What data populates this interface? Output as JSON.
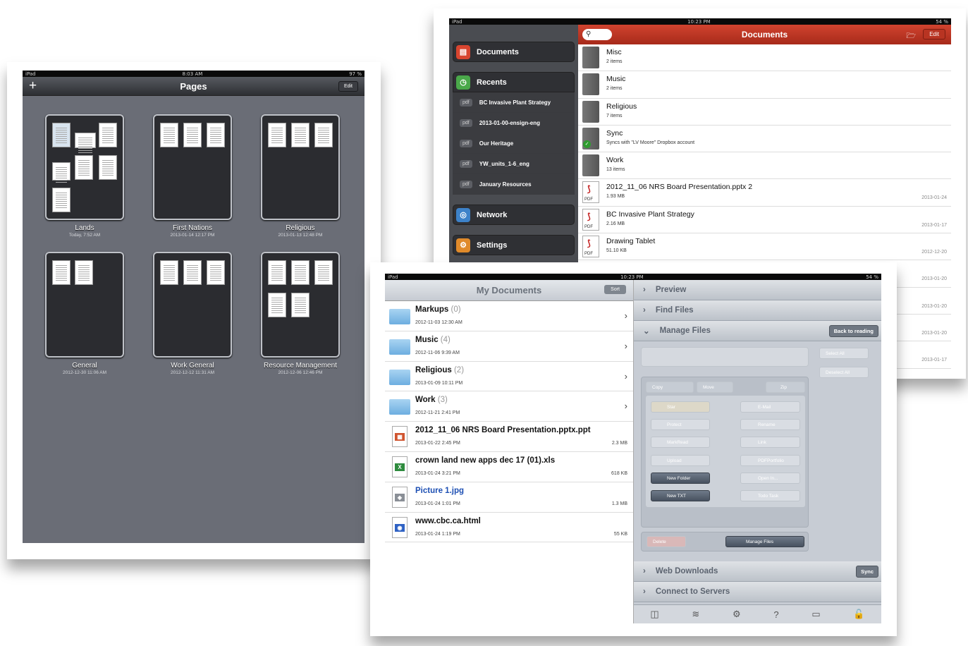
{
  "pages_app": {
    "status": {
      "left": "iPad",
      "time": "8:03 AM",
      "right": "97 %"
    },
    "nav": {
      "plus": "+",
      "title": "Pages",
      "edit": "Edit"
    },
    "folders": [
      {
        "name": "Lands",
        "date": "Today, 7:52 AM"
      },
      {
        "name": "First Nations",
        "date": "2013-01-14 12:17 PM"
      },
      {
        "name": "Religious",
        "date": "2013-01-13 12:48 PM"
      },
      {
        "name": "General",
        "date": "2012-12-30 11:06 AM"
      },
      {
        "name": "Work General",
        "date": "2012-12-12 11:31 AM"
      },
      {
        "name": "Resource Management",
        "date": "2012-12-06 12:46 PM"
      }
    ]
  },
  "documents_app": {
    "status": {
      "left": "iPad",
      "time": "10:23 PM",
      "right": "54 %"
    },
    "sidebar": {
      "documents": "Documents",
      "recents": "Recents",
      "recent_items": [
        {
          "tag": "pdf",
          "label": "BC Invasive Plant Strategy"
        },
        {
          "tag": "pdf",
          "label": "2013-01-00-ensign-eng"
        },
        {
          "tag": "pdf",
          "label": "Our Heritage"
        },
        {
          "tag": "pdf",
          "label": "YW_units_1-6_eng"
        },
        {
          "tag": "pdf",
          "label": "January Resources"
        }
      ],
      "network": "Network",
      "settings": "Settings"
    },
    "header": {
      "title": "Documents",
      "edit": "Edit"
    },
    "rows": [
      {
        "name": "Misc",
        "sub": "2 items",
        "date": "",
        "type": "folder"
      },
      {
        "name": "Music",
        "sub": "2 items",
        "date": "",
        "type": "folder"
      },
      {
        "name": "Religious",
        "sub": "7 items",
        "date": "",
        "type": "folder"
      },
      {
        "name": "Sync",
        "sub": "Syncs with \"LV Moore\" Dropbox account",
        "date": "",
        "type": "folder"
      },
      {
        "name": "Work",
        "sub": "13 items",
        "date": "",
        "type": "folder"
      },
      {
        "name": "2012_11_06 NRS Board Presentation.pptx 2",
        "sub": "1.93 MB",
        "date": "2013-01-24",
        "type": "pdf"
      },
      {
        "name": "BC Invasive Plant Strategy",
        "sub": "2.16 MB",
        "date": "2013-01-17",
        "type": "pdf"
      },
      {
        "name": "Drawing Tablet",
        "sub": "51.10 KB",
        "date": "2012-12-20",
        "type": "pdf"
      },
      {
        "name": "",
        "sub": "",
        "date": "2013-01-20",
        "type": "hidden"
      },
      {
        "name": "",
        "sub": "",
        "date": "2013-01-20",
        "type": "hidden"
      },
      {
        "name": "",
        "sub": "",
        "date": "2013-01-20",
        "type": "hidden"
      },
      {
        "name": "",
        "sub": "",
        "date": "2013-01-17",
        "type": "hidden"
      }
    ],
    "pdf_tag": "PDF"
  },
  "goodreader": {
    "status": {
      "left": "iPad",
      "time": "10:23 PM",
      "right": "54 %"
    },
    "list_header": {
      "title": "My Documents",
      "sort": "Sort"
    },
    "files": [
      {
        "name": "Markups",
        "count": "(0)",
        "date": "2012-11-03 12:30 AM",
        "size": "",
        "type": "folder"
      },
      {
        "name": "Music",
        "count": "(4)",
        "date": "2012-11-06 9:39 AM",
        "size": "",
        "type": "folder"
      },
      {
        "name": "Religious",
        "count": "(2)",
        "date": "2013-01-09 10:11 PM",
        "size": "",
        "type": "folder"
      },
      {
        "name": "Work",
        "count": "(3)",
        "date": "2012-11-21 2:41 PM",
        "size": "",
        "type": "folder"
      },
      {
        "name": "2012_11_06 NRS Board Presentation.pptx.ppt",
        "count": "",
        "date": "2013-01-22 2:45 PM",
        "size": "2.3 MB",
        "type": "ppt"
      },
      {
        "name": "crown land new apps dec 17 (01).xls",
        "count": "",
        "date": "2013-01-24 3:21 PM",
        "size": "618 KB",
        "type": "xls"
      },
      {
        "name": "Picture 1.jpg",
        "count": "",
        "date": "2013-01-24 1:01 PM",
        "size": "1.3 MB",
        "type": "jpg"
      },
      {
        "name": "www.cbc.ca.html",
        "count": "",
        "date": "2013-01-24 1:19 PM",
        "size": "55 KB",
        "type": "html"
      }
    ],
    "panel": {
      "preview": "Preview",
      "find": "Find Files",
      "manage": "Manage Files",
      "back": "Back to reading",
      "select_all": "Select All",
      "deselect_all": "Deselect All",
      "copy": "Copy",
      "move": "Move",
      "zip": "Zip",
      "actions_left": [
        "Star",
        "Protect",
        "MarkRead",
        "Upload",
        "New Folder",
        "New TXT"
      ],
      "actions_right": [
        "E-Mail",
        "Rename",
        "Link",
        "PDFPortfolio",
        "Open In...",
        "Todo Task"
      ],
      "delete": "Delete",
      "manage_btn": "Manage Files",
      "web": "Web Downloads",
      "sync": "Sync",
      "connect": "Connect to Servers"
    },
    "colors": {
      "accent": "#d1432f",
      "pages_bg": "#6a6d76"
    }
  }
}
